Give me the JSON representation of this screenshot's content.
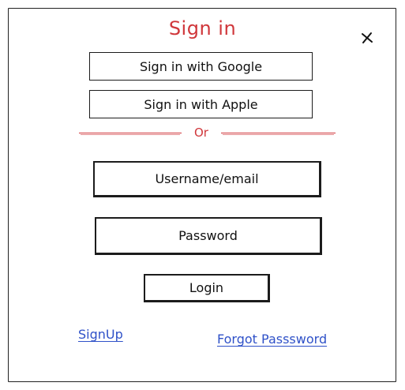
{
  "dialog": {
    "title": "Sign in",
    "close_icon": "close-icon"
  },
  "providers": {
    "google_label": "Sign in with Google",
    "apple_label": "Sign in with Apple"
  },
  "divider": {
    "label": "Or"
  },
  "form": {
    "username_placeholder": "Username/email",
    "username_value": "",
    "password_placeholder": "Password",
    "password_value": "",
    "login_label": "Login"
  },
  "links": {
    "signup_label": "SignUp",
    "forgot_label": "Forgot Passsword"
  },
  "colors": {
    "accent_red": "#d0373b",
    "link_blue": "#2f51c8",
    "stroke": "#1c1c1c"
  }
}
